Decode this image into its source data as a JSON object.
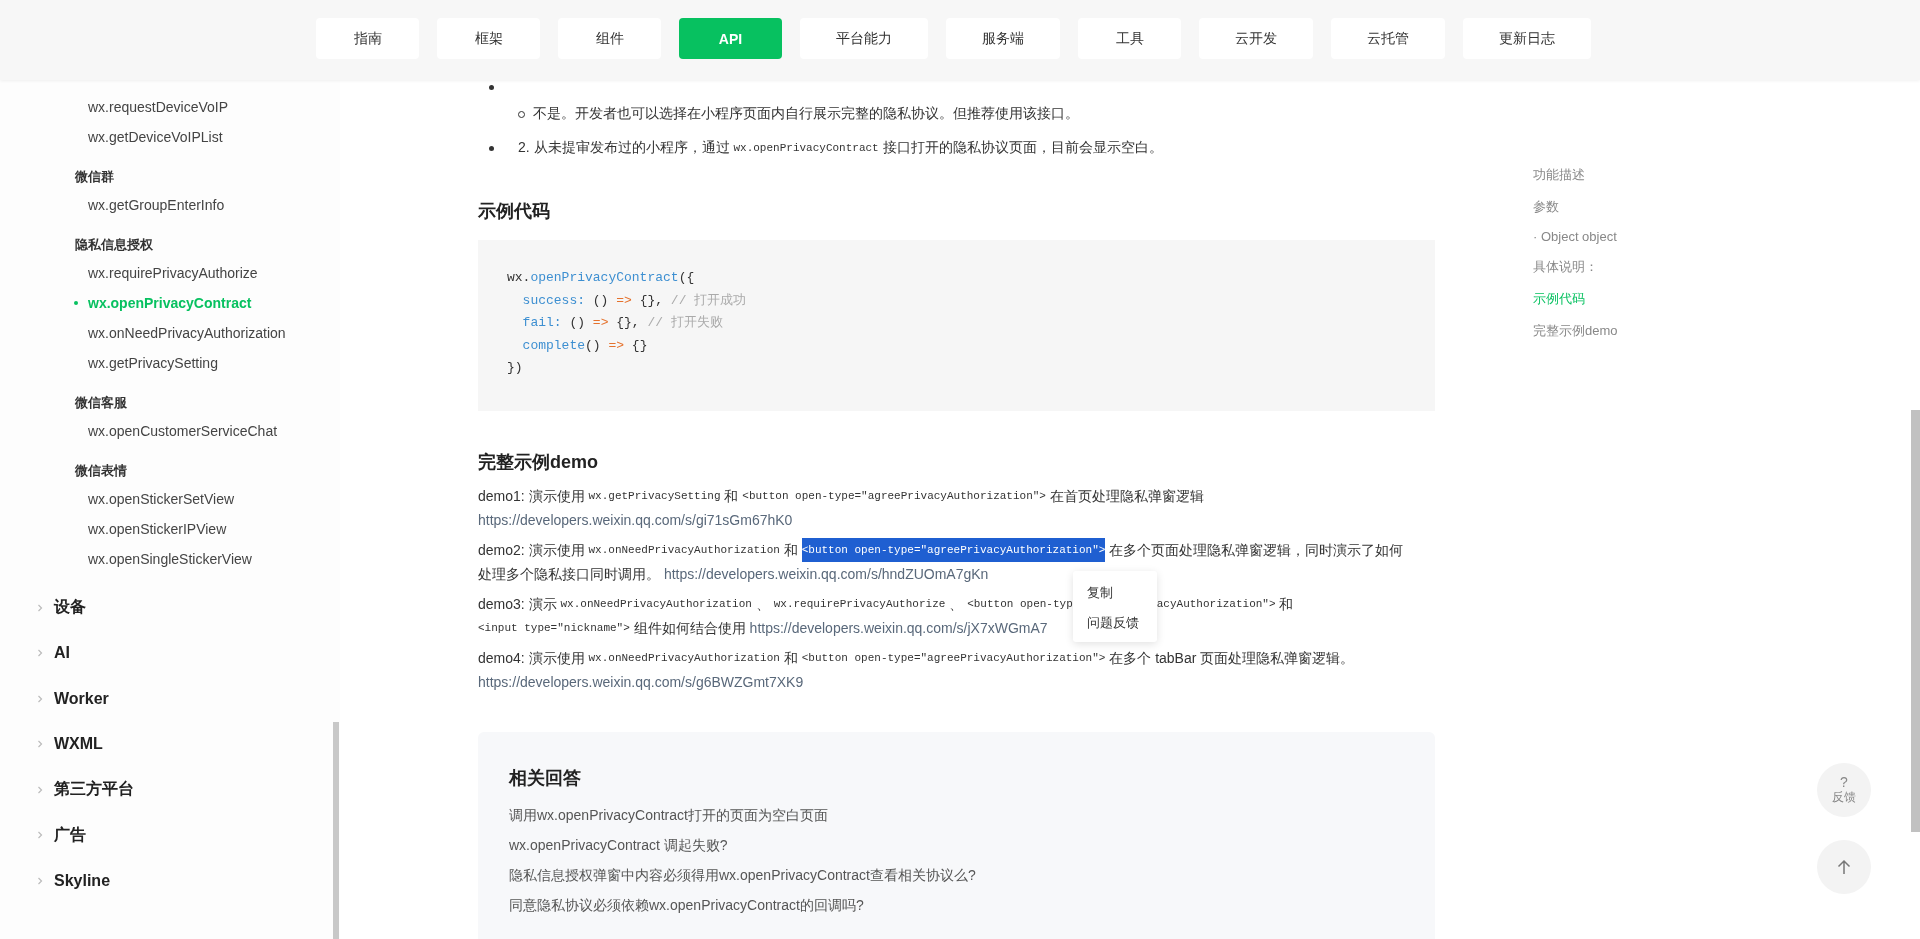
{
  "nav": {
    "tabs": [
      {
        "label": "指南",
        "selected": false
      },
      {
        "label": "框架",
        "selected": false
      },
      {
        "label": "组件",
        "selected": false
      },
      {
        "label": "API",
        "selected": true
      },
      {
        "label": "平台能力",
        "selected": false
      },
      {
        "label": "服务端",
        "selected": false
      },
      {
        "label": "工具",
        "selected": false
      },
      {
        "label": "云开发",
        "selected": false
      },
      {
        "label": "云托管",
        "selected": false
      },
      {
        "label": "更新日志",
        "selected": false
      }
    ]
  },
  "sidebar": {
    "groups": [
      {
        "items": [
          {
            "label": "wx.requestDeviceVoIP",
            "selected": false
          },
          {
            "label": "wx.getDeviceVoIPList",
            "selected": false
          }
        ]
      },
      {
        "title": "微信群",
        "items": [
          {
            "label": "wx.getGroupEnterInfo",
            "selected": false
          }
        ]
      },
      {
        "title": "隐私信息授权",
        "items": [
          {
            "label": "wx.requirePrivacyAuthorize",
            "selected": false
          },
          {
            "label": "wx.openPrivacyContract",
            "selected": true
          },
          {
            "label": "wx.onNeedPrivacyAuthorization",
            "selected": false
          },
          {
            "label": "wx.getPrivacySetting",
            "selected": false
          }
        ]
      },
      {
        "title": "微信客服",
        "items": [
          {
            "label": "wx.openCustomerServiceChat",
            "selected": false
          }
        ]
      },
      {
        "title": "微信表情",
        "items": [
          {
            "label": "wx.openStickerSetView",
            "selected": false
          },
          {
            "label": "wx.openStickerIPView",
            "selected": false
          },
          {
            "label": "wx.openSingleStickerView",
            "selected": false
          }
        ]
      }
    ],
    "categories": [
      {
        "label": "设备",
        "expanded": false
      },
      {
        "label": "AI",
        "expanded": false
      },
      {
        "label": "Worker",
        "expanded": false
      },
      {
        "label": "WXML",
        "expanded": false
      },
      {
        "label": "第三方平台",
        "expanded": false
      },
      {
        "label": "广告",
        "expanded": false
      },
      {
        "label": "Skyline",
        "expanded": false
      }
    ]
  },
  "article": {
    "notes": [
      {
        "children": [
          {
            "segments": [
              {
                "kind": "text",
                "text": "不是。开发者也可以选择在小程序页面内自行展示完整的隐私协议。但推荐使用该接口。"
              }
            ]
          }
        ]
      },
      {
        "segments": [
          {
            "kind": "text",
            "text": "2. 从未提审发布过的小程序，通过 "
          },
          {
            "kind": "code",
            "text": "wx.openPrivacyContract"
          },
          {
            "kind": "text",
            "text": " 接口打开的隐私协议页面，目前会显示空白。"
          }
        ]
      }
    ],
    "sample_heading": "示例代码",
    "code_lines": [
      [
        {
          "kind": "plain",
          "text": "wx."
        },
        {
          "kind": "name",
          "text": "openPrivacyContract"
        },
        {
          "kind": "plain",
          "text": "({"
        }
      ],
      [
        {
          "kind": "name",
          "text": "  success:"
        },
        {
          "kind": "plain",
          "text": " () "
        },
        {
          "kind": "op",
          "text": "=>"
        },
        {
          "kind": "plain",
          "text": " {}, "
        },
        {
          "kind": "comment",
          "text": "// 打开成功"
        }
      ],
      [
        {
          "kind": "name",
          "text": "  fail:"
        },
        {
          "kind": "plain",
          "text": " () "
        },
        {
          "kind": "op",
          "text": "=>"
        },
        {
          "kind": "plain",
          "text": " {}, "
        },
        {
          "kind": "comment",
          "text": "// 打开失败"
        }
      ],
      [
        {
          "kind": "name",
          "text": "  complete"
        },
        {
          "kind": "plain",
          "text": "() "
        },
        {
          "kind": "op",
          "text": "=>"
        },
        {
          "kind": "plain",
          "text": " {}"
        }
      ],
      [
        {
          "kind": "plain",
          "text": "})"
        }
      ]
    ],
    "demo_heading": "完整示例demo",
    "demos": [
      {
        "lines": [
          [
            {
              "kind": "text",
              "text": "demo1: 演示使用 "
            },
            {
              "kind": "code",
              "text": "wx.getPrivacySetting",
              "selected": false
            },
            {
              "kind": "text",
              "text": " 和 "
            },
            {
              "kind": "code",
              "text": "<button open-type=\"agreePrivacyAuthorization\">",
              "selected": false
            },
            {
              "kind": "text",
              "text": " 在首页处理隐私弹窗逻辑"
            }
          ],
          [
            {
              "kind": "link",
              "text": "https://developers.weixin.qq.com/s/gi71sGm67hK0"
            }
          ]
        ]
      },
      {
        "lines": [
          [
            {
              "kind": "text",
              "text": "demo2: 演示使用 "
            },
            {
              "kind": "code",
              "text": "wx.onNeedPrivacyAuthorization",
              "selected": false
            },
            {
              "kind": "text",
              "text": " 和 "
            },
            {
              "kind": "code",
              "text": "<button open-type=\"agreePrivacyAuthorization\">",
              "selected": true
            },
            {
              "kind": "text",
              "text": " 在多个页面处理隐私弹窗逻辑，同时演示了如何"
            }
          ],
          [
            {
              "kind": "text",
              "text": "处理多个隐私接口同时调用。 "
            },
            {
              "kind": "link",
              "text": "https://developers.weixin.qq.com/s/hndZUOmA7gKn"
            }
          ]
        ]
      },
      {
        "lines": [
          [
            {
              "kind": "text",
              "text": "demo3: 演示 "
            },
            {
              "kind": "code",
              "text": "wx.onNeedPrivacyAuthorization",
              "selected": false
            },
            {
              "kind": "text",
              "text": " 、 "
            },
            {
              "kind": "code",
              "text": "wx.requirePrivacyAuthorize",
              "selected": false
            },
            {
              "kind": "text",
              "text": " 、 "
            },
            {
              "kind": "code",
              "text": "<button open-typ",
              "selected": false
            },
            {
              "kind": "menu"
            },
            {
              "kind": "code",
              "text": "acyAuthorization\">",
              "selected": false
            },
            {
              "kind": "text",
              "text": " 和"
            }
          ],
          [
            {
              "kind": "code",
              "text": "<input type=\"nickname\">",
              "selected": false
            },
            {
              "kind": "text",
              "text": " 组件如何结合使用 "
            },
            {
              "kind": "link",
              "text": "https://developers.weixin.qq.com/s/jX7xWGmA7"
            }
          ]
        ]
      },
      {
        "lines": [
          [
            {
              "kind": "text",
              "text": "demo4: 演示使用 "
            },
            {
              "kind": "code",
              "text": "wx.onNeedPrivacyAuthorization",
              "selected": false
            },
            {
              "kind": "text",
              "text": " 和 "
            },
            {
              "kind": "code",
              "text": "<button open-type=\"agreePrivacyAuthorization\">",
              "selected": false
            },
            {
              "kind": "text",
              "text": " 在多个 tabBar 页面处理隐私弹窗逻辑。"
            }
          ],
          [
            {
              "kind": "link",
              "text": "https://developers.weixin.qq.com/s/g6BWZGmt7XK9"
            }
          ]
        ]
      }
    ]
  },
  "context_menu": {
    "items": [
      "复制",
      "问题反馈"
    ]
  },
  "related": {
    "title": "相关回答",
    "links": [
      "调用wx.openPrivacyContract打开的页面为空白页面",
      "wx.openPrivacyContract 调起失败?",
      "隐私信息授权弹窗中内容必须得用wx.openPrivacyContract查看相关协议么?",
      "同意隐私协议必须依赖wx.openPrivacyContract的回调吗?"
    ]
  },
  "toc": {
    "items": [
      {
        "label": "功能描述",
        "selected": false
      },
      {
        "label": "参数",
        "selected": false,
        "children": [
          {
            "label": "· Object object",
            "selected": false
          }
        ]
      },
      {
        "label": "具体说明：",
        "selected": false
      },
      {
        "label": "示例代码",
        "selected": true
      },
      {
        "label": "完整示例demo",
        "selected": false
      }
    ]
  },
  "feedback_button": {
    "icon": "?",
    "label": "反馈"
  }
}
